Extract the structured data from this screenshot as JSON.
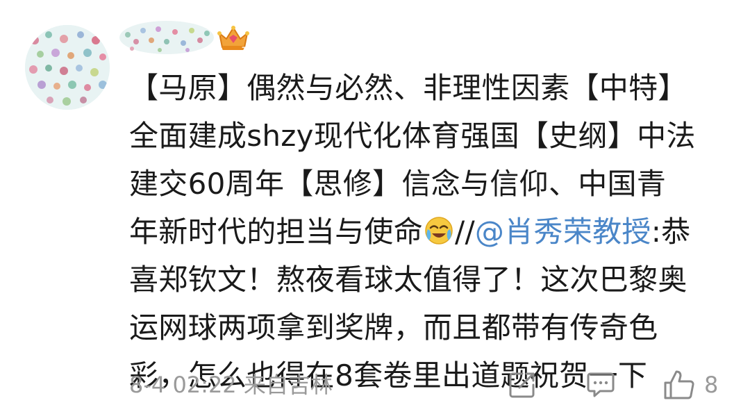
{
  "post": {
    "avatar_icon": "polka-dot-avatar",
    "username_icon": "blurred-username",
    "badge_icon": "crown-badge-icon",
    "lines": {
      "l1": "【马原】偶然与必然、非理性因素【中特】",
      "l2": "全面建成shzy现代化体育强国【史纲】中法",
      "l3": "建交60周年【思修】信念与信仰、中国青",
      "l4a": "年新时代的担当与使命",
      "l4_emoji": "crying-laughing-emoji",
      "l4b": "//",
      "l4_mention": "@肖秀荣教授",
      "l4c": ":恭",
      "l5": "喜郑钦文！熬夜看球太值得了！这次巴黎奥",
      "l6": "运网球两项拿到奖牌，而且都带有传奇色",
      "l7": "彩，怎么也得在8套卷里出道题祝贺一下"
    },
    "meta": "8-4 02:22 来自吉林",
    "actions": {
      "share_icon": "share-edit-icon",
      "comment_icon": "comment-icon",
      "like_icon": "thumbs-up-icon",
      "like_count": "8"
    },
    "colors": {
      "text": "#1a1a1a",
      "mention": "#4a86c8",
      "meta": "#9a9a9a"
    }
  }
}
